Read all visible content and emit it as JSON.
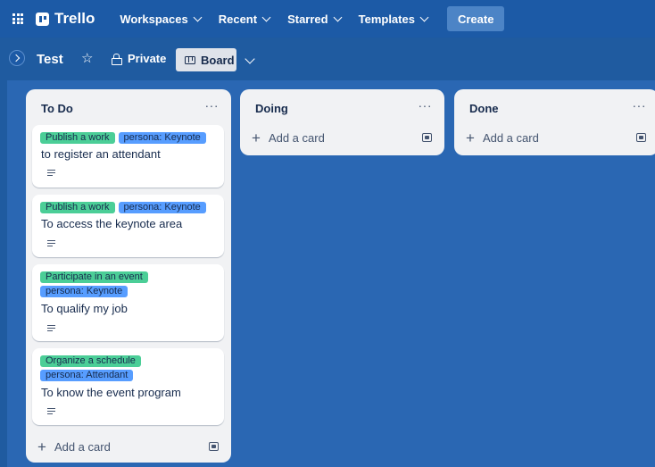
{
  "topbar": {
    "logo": "Trello",
    "nav": [
      "Workspaces",
      "Recent",
      "Starred",
      "Templates"
    ],
    "create_label": "Create"
  },
  "board": {
    "title": "Test",
    "visibility": "Private",
    "view_label": "Board"
  },
  "lists": [
    {
      "title": "To Do",
      "menu": "···",
      "add_card_label": "Add a card",
      "cards": [
        {
          "labels": [
            {
              "text": "Publish a work",
              "color": "#4bce97"
            },
            {
              "text": "persona: Keynote",
              "color": "#579dff"
            }
          ],
          "text": "to register an attendant",
          "has_description": true
        },
        {
          "labels": [
            {
              "text": "Publish a work",
              "color": "#4bce97"
            },
            {
              "text": "persona: Keynote",
              "color": "#579dff"
            }
          ],
          "text": "To access the keynote area",
          "has_description": true
        },
        {
          "labels": [
            {
              "text": "Participate in an event",
              "color": "#4bce97"
            },
            {
              "text": "persona: Keynote",
              "color": "#579dff"
            }
          ],
          "text": "To qualify my job",
          "has_description": true
        },
        {
          "labels": [
            {
              "text": "Organize a schedule",
              "color": "#4bce97"
            },
            {
              "text": "persona: Attendant",
              "color": "#579dff"
            }
          ],
          "text": "To know the event program",
          "has_description": true
        }
      ]
    },
    {
      "title": "Doing",
      "menu": "···",
      "add_card_label": "Add a card",
      "cards": []
    },
    {
      "title": "Done",
      "menu": "···",
      "add_card_label": "Add a card",
      "cards": []
    }
  ],
  "colors": {
    "board_background": "#2a67b3",
    "topbar": "#1c5aa6",
    "list_background": "#f1f2f4",
    "label_green": "#4bce97",
    "label_blue": "#579dff"
  },
  "icons": [
    "apps-grid-icon",
    "trello-logo-icon",
    "chevron-down-icon",
    "star-icon",
    "lock-icon",
    "board-icon",
    "ellipsis-icon",
    "plus-icon",
    "template-icon",
    "description-icon",
    "chevron-right-icon"
  ]
}
